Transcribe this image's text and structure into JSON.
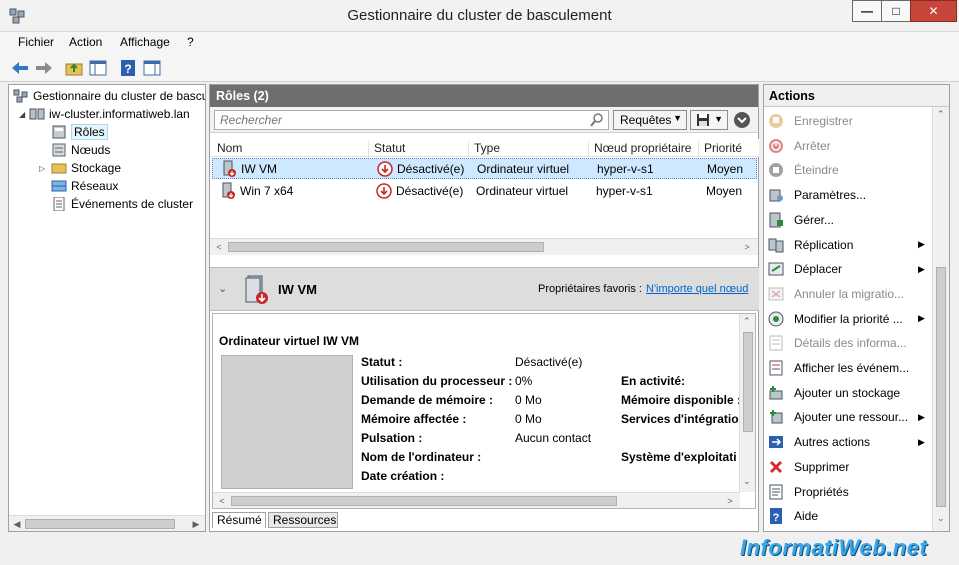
{
  "window": {
    "title": "Gestionnaire du cluster de basculement",
    "min": "—",
    "max": "□",
    "close": "✕"
  },
  "menu": [
    "Fichier",
    "Action",
    "Affichage",
    "?"
  ],
  "toolbar": [
    "back-icon",
    "forward-icon",
    "folder-up-icon",
    "console-tree-icon",
    "help-icon",
    "action-pane-icon"
  ],
  "tree": {
    "root": "Gestionnaire du cluster de basculement",
    "cluster": "iw-cluster.informatiweb.lan",
    "items": [
      "Rôles",
      "Nœuds",
      "Stockage",
      "Réseaux",
      "Événements de cluster"
    ]
  },
  "roles": {
    "header": "Rôles (2)",
    "search_placeholder": "Rechercher",
    "queries_label": "Requêtes",
    "columns": [
      "Nom",
      "Statut",
      "Type",
      "Nœud propriétaire",
      "Priorité"
    ],
    "rows": [
      [
        "IW VM",
        "Désactivé(e)",
        "Ordinateur virtuel",
        "hyper-v-s1",
        "Moyen"
      ],
      [
        "Win 7 x64",
        "Désactivé(e)",
        "Ordinateur virtuel",
        "hyper-v-s1",
        "Moyen"
      ]
    ]
  },
  "detail": {
    "name": "IW VM",
    "owners_label": "Propriétaires favoris :",
    "owners_link": "N'importe quel nœud",
    "section_title": "Ordinateur virtuel IW VM",
    "left": [
      {
        "label": "Statut :",
        "value": "Désactivé(e)"
      },
      {
        "label": "Utilisation du processeur :",
        "value": "0%"
      },
      {
        "label": "Demande de mémoire :",
        "value": "0 Mo"
      },
      {
        "label": "Mémoire affectée :",
        "value": "0 Mo"
      },
      {
        "label": "Pulsation :",
        "value": "Aucun contact"
      },
      {
        "label": "Nom de l'ordinateur :",
        "value": ""
      },
      {
        "label": "Date création :",
        "value": ""
      }
    ],
    "right": [
      "En activité:",
      "Mémoire disponible :",
      "Services d'intégratio",
      "Système d'exploitati"
    ],
    "tabs": [
      "Résumé",
      "Ressources"
    ]
  },
  "actions": {
    "header": "Actions",
    "items": [
      {
        "label": "Enregistrer",
        "icon": "save-state-icon",
        "disabled": true,
        "sub": false
      },
      {
        "label": "Arrêter",
        "icon": "shutdown-icon",
        "disabled": true,
        "sub": false
      },
      {
        "label": "Éteindre",
        "icon": "turn-off-icon",
        "disabled": true,
        "sub": false
      },
      {
        "label": "Paramètres...",
        "icon": "settings-icon",
        "disabled": false,
        "sub": false
      },
      {
        "label": "Gérer...",
        "icon": "manage-icon",
        "disabled": false,
        "sub": false
      },
      {
        "label": "Réplication",
        "icon": "replication-icon",
        "disabled": false,
        "sub": true
      },
      {
        "label": "Déplacer",
        "icon": "move-icon",
        "disabled": false,
        "sub": true
      },
      {
        "label": "Annuler la migratio...",
        "icon": "cancel-migration-icon",
        "disabled": true,
        "sub": false
      },
      {
        "label": "Modifier la priorité ...",
        "icon": "priority-icon",
        "disabled": false,
        "sub": true
      },
      {
        "label": "Détails des informa...",
        "icon": "details-icon",
        "disabled": true,
        "sub": false
      },
      {
        "label": "Afficher les événem...",
        "icon": "events-icon",
        "disabled": false,
        "sub": false
      },
      {
        "label": "Ajouter un stockage",
        "icon": "add-storage-icon",
        "disabled": false,
        "sub": false
      },
      {
        "label": "Ajouter une ressour...",
        "icon": "add-resource-icon",
        "disabled": false,
        "sub": true
      },
      {
        "label": "Autres actions",
        "icon": "more-actions-icon",
        "disabled": false,
        "sub": true
      },
      {
        "label": "Supprimer",
        "icon": "delete-icon",
        "disabled": false,
        "sub": false
      },
      {
        "label": "Propriétés",
        "icon": "properties-icon",
        "disabled": false,
        "sub": false
      },
      {
        "label": "Aide",
        "icon": "help-icon",
        "disabled": false,
        "sub": false
      }
    ]
  },
  "watermark": "InformatiWeb.net",
  "colors": {
    "accent": "#6e6e6e",
    "selection": "#cde8ff",
    "link": "#0066cc",
    "disabled_red": "#d04040"
  }
}
